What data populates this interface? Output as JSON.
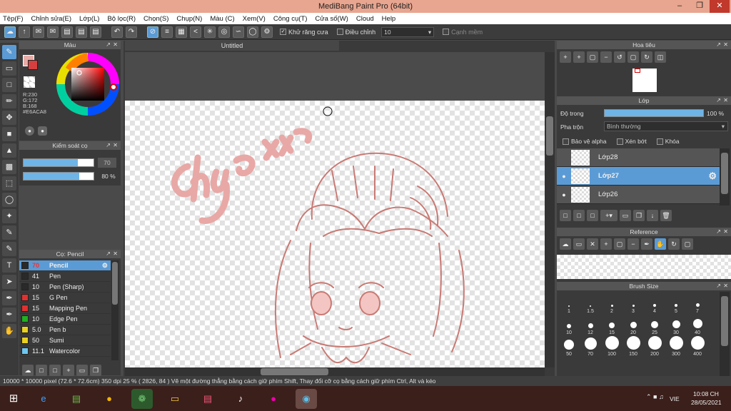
{
  "window": {
    "title": "MediBang Paint Pro (64bit)"
  },
  "menu": [
    "Tệp(F)",
    "Chỉnh sửa(E)",
    "Lớp(L)",
    "Bộ lọc(R)",
    "Chọn(S)",
    "Chụp(N)",
    "Màu (C)",
    "Xem(V)",
    "Công cụ(T)",
    "Cửa số(W)",
    "Cloud",
    "Help"
  ],
  "toolbar": {
    "antialias_label": "Khử răng cưa",
    "adjust_label": "Điều chỉnh",
    "adjust_value": "10",
    "edge_label": "Cạnh mềm"
  },
  "color_panel": {
    "title": "Màu",
    "r": "R:230",
    "g": "G:172",
    "b": "B:168",
    "hex": "#E6ACA8",
    "primary": "#E6ACA8"
  },
  "brush_control": {
    "title": "Kiểm soát cọ",
    "size_value": "70",
    "opacity_value": "80 %",
    "size_fill": 0.78,
    "opacity_fill": 0.8
  },
  "brush_panel": {
    "title": "Cọ: Pencil",
    "items": [
      {
        "size": "70",
        "name": "Pencil",
        "color": "#2a2a2a"
      },
      {
        "size": "41",
        "name": "Pen",
        "color": "#2a2a2a"
      },
      {
        "size": "10",
        "name": "Pen (Sharp)",
        "color": "#2a2a2a"
      },
      {
        "size": "15",
        "name": "G Pen",
        "color": "#e03030"
      },
      {
        "size": "15",
        "name": "Mapping Pen",
        "color": "#e03030"
      },
      {
        "size": "10",
        "name": "Edge Pen",
        "color": "#20b020"
      },
      {
        "size": "5.0",
        "name": "Pen b",
        "color": "#e8d020"
      },
      {
        "size": "50",
        "name": "Sumi",
        "color": "#e8d020"
      },
      {
        "size": "11.1",
        "name": "Watercolor",
        "color": "#6ec6f0"
      }
    ]
  },
  "document": {
    "tab": "Untitled"
  },
  "navigator": {
    "title": "Hoa tiêu"
  },
  "layer_panel": {
    "title": "Lớp",
    "opacity_label": "Độ trong",
    "opacity_value": "100 %",
    "blend_label": "Pha trộn",
    "blend_value": "Bình thường",
    "protect_alpha": "Bảo vệ alpha",
    "clipping": "Xén bớt",
    "lock": "Khóa",
    "layers": [
      {
        "name": "Lớp28",
        "visible": false
      },
      {
        "name": "Lớp27",
        "visible": true
      },
      {
        "name": "Lớp26",
        "visible": true
      }
    ]
  },
  "reference": {
    "title": "Reference"
  },
  "brush_size": {
    "title": "Brush Size",
    "sizes": [
      "1",
      "1.5",
      "2",
      "3",
      "4",
      "5",
      "7",
      "10",
      "12",
      "15",
      "20",
      "25",
      "30",
      "40",
      "50",
      "70",
      "100",
      "150",
      "200",
      "300",
      "400"
    ]
  },
  "status": "10000 * 10000 pixel   (72.6 * 72.6cm)   350 dpi   25 %   ( 2826, 84 )   Vẽ một đường thẳng bằng cách giữ phím Shift, Thay đổi cỡ cọ bằng cách giữ phím Ctrl, Alt và kéo",
  "taskbar": {
    "lang": "VIE",
    "time": "10:08 CH",
    "date": "28/05/2021"
  }
}
